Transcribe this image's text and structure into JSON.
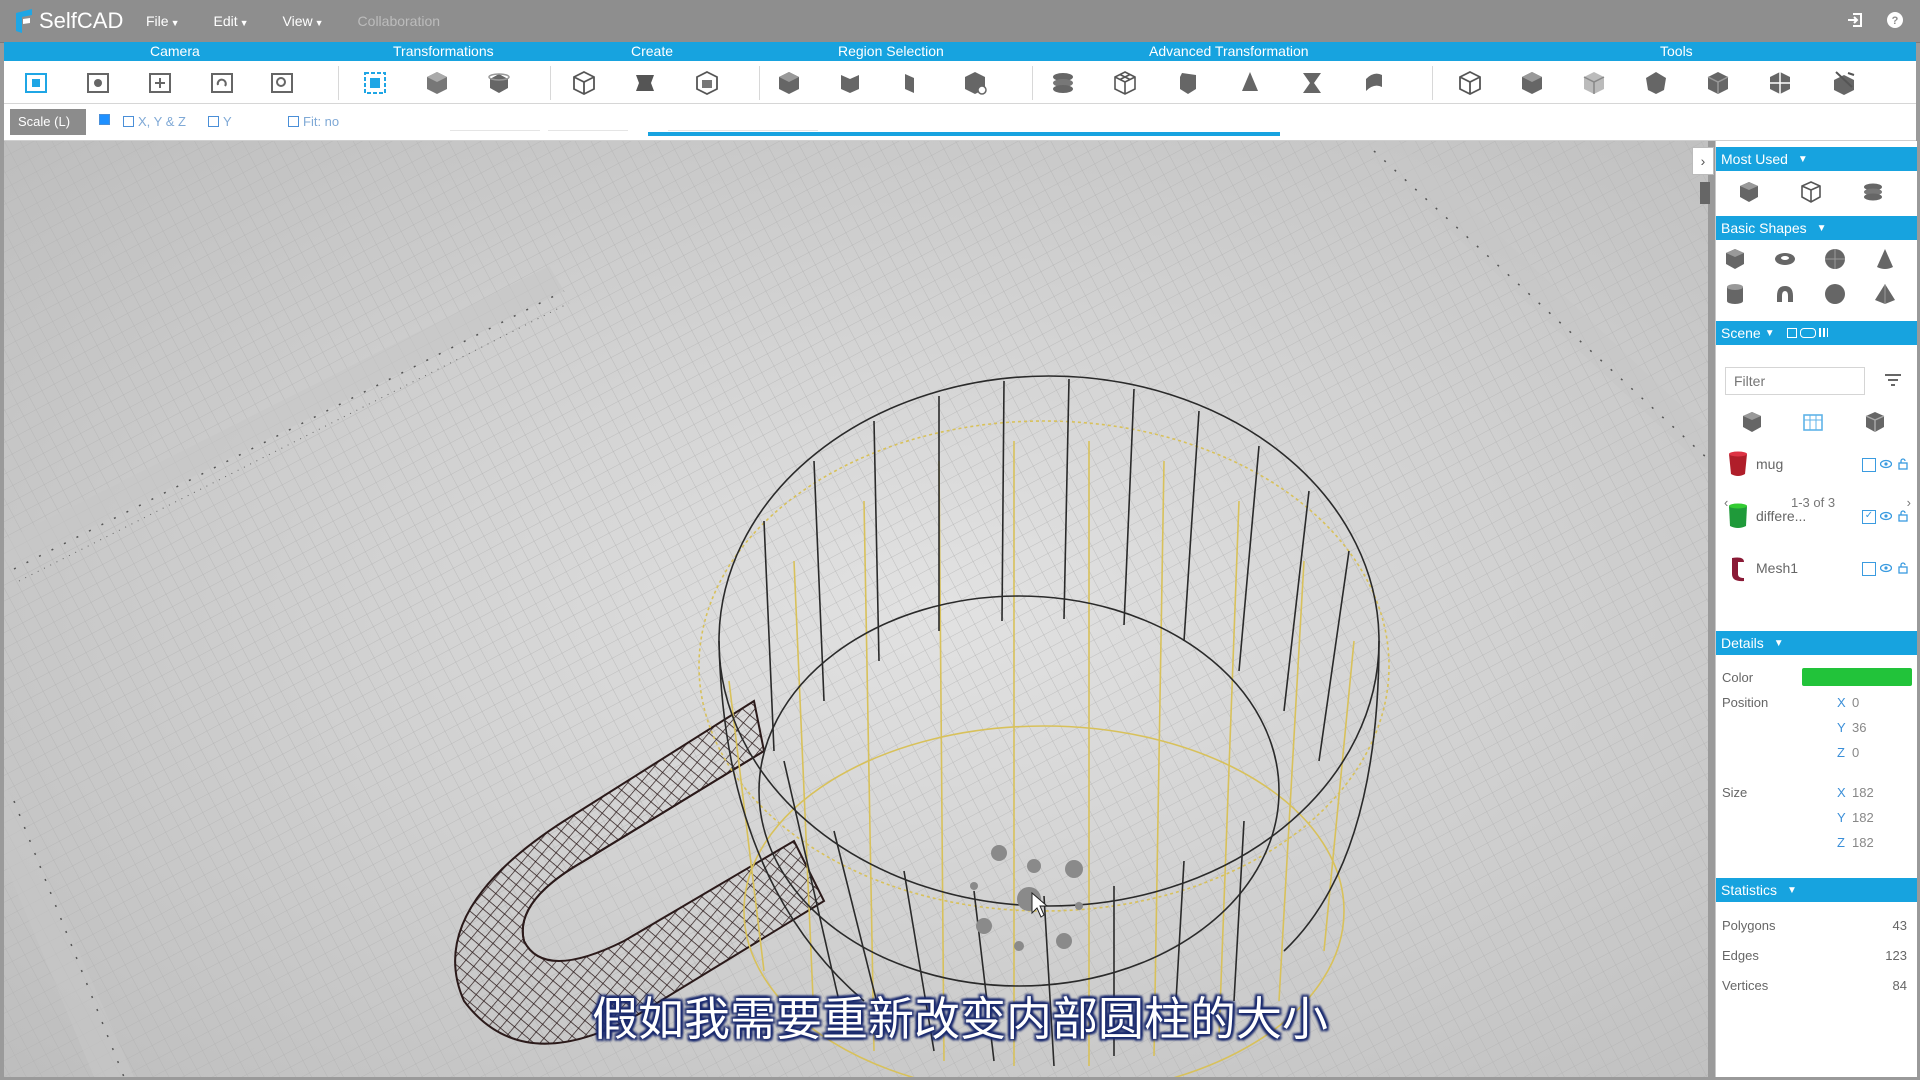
{
  "app": {
    "name": "SelfCAD"
  },
  "menu": {
    "file": "File",
    "edit": "Edit",
    "view": "View",
    "collaboration": "Collaboration"
  },
  "categories": {
    "camera": "Camera",
    "transformations": "Transformations",
    "create": "Create",
    "region_selection": "Region Selection",
    "advanced_transformation": "Advanced Transformation",
    "tools": "Tools"
  },
  "subbar": {
    "scale_label": "Scale (L)",
    "opt_xyz": "X, Y & Z",
    "opt_y": "Y",
    "opt_fix_ratio": "Fit: no"
  },
  "panel": {
    "most_used": "Most Used",
    "basic_shapes": "Basic Shapes",
    "scene": "Scene",
    "filter_placeholder": "Filter",
    "objects": [
      {
        "name": "mug",
        "color": "#b01e2a",
        "checked": false
      },
      {
        "name": "differe...",
        "color": "#1f9a3a",
        "checked": true
      },
      {
        "name": "Mesh1",
        "color": "#8a1a36",
        "checked": false
      }
    ],
    "pager": "1-3 of 3",
    "details": "Details",
    "color_label": "Color",
    "color_value": "#22c33a",
    "position_label": "Position",
    "position": {
      "x": "0",
      "y": "36",
      "z": "0"
    },
    "size_label": "Size",
    "size": {
      "x": "182",
      "y": "182",
      "z": "182"
    },
    "statistics": "Statistics",
    "polygons_label": "Polygons",
    "polygons": "43",
    "edges_label": "Edges",
    "edges": "123",
    "vertices_label": "Vertices",
    "vertices": "84"
  },
  "axis": {
    "x": "X",
    "y": "Y",
    "z": "Z"
  },
  "viewport": {
    "subtitle": "假如我需要重新改变内部圆柱的大小"
  }
}
